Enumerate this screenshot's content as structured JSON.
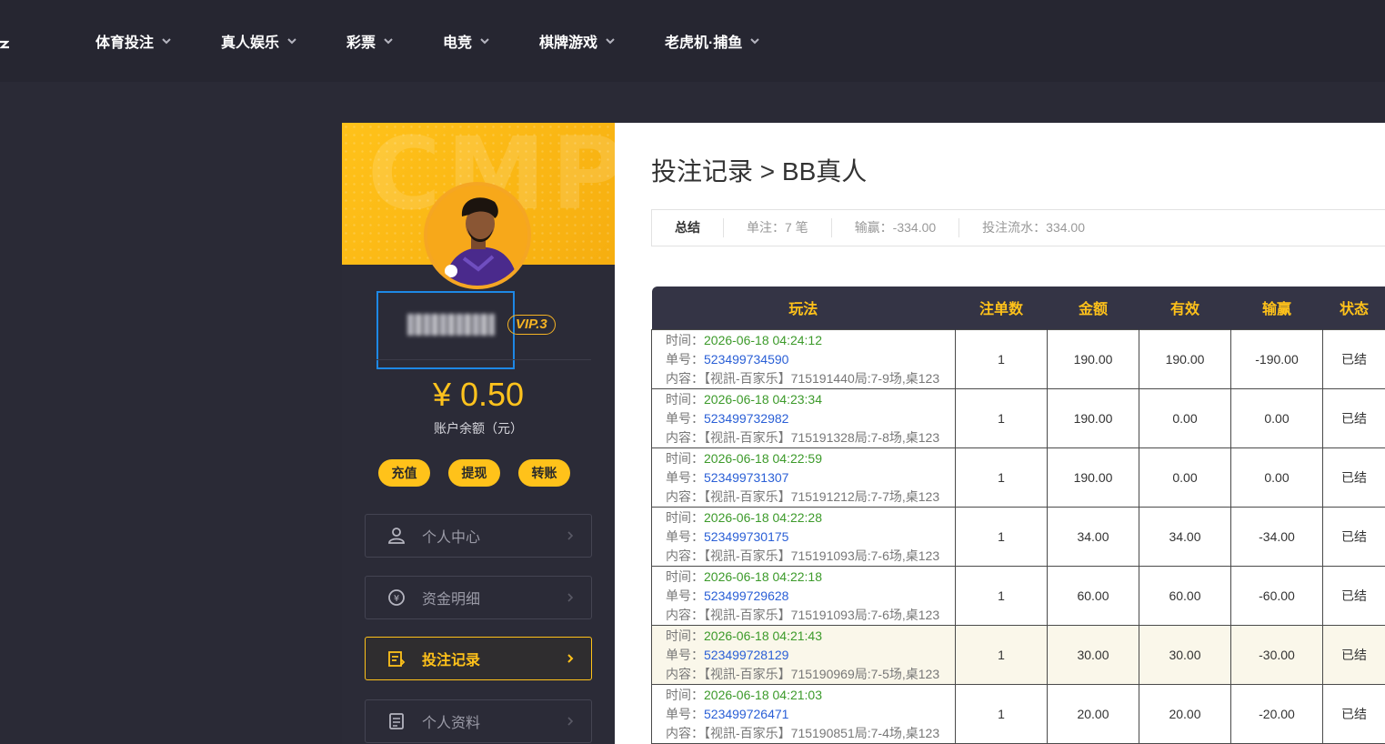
{
  "nav": {
    "items": [
      {
        "label": "体育投注"
      },
      {
        "label": "真人娱乐"
      },
      {
        "label": "彩票"
      },
      {
        "label": "电竞"
      },
      {
        "label": "棋牌游戏"
      },
      {
        "label": "老虎机·捕鱼"
      }
    ]
  },
  "sidebar": {
    "vip": "VIP.3",
    "balance": "¥ 0.50",
    "balance_label": "账户余额（元）",
    "actions": {
      "deposit": "充值",
      "withdraw": "提现",
      "transfer": "转账"
    },
    "menu": [
      {
        "label": "个人中心",
        "icon": "user-icon"
      },
      {
        "label": "资金明细",
        "icon": "yuan-cycle-icon"
      },
      {
        "label": "投注记录",
        "icon": "bet-record-icon",
        "active": true
      },
      {
        "label": "个人资料",
        "icon": "profile-doc-icon"
      }
    ],
    "accent_color": "#ffc21a"
  },
  "main": {
    "title": "投注记录 > BB真人",
    "summary": {
      "label": "总结",
      "bets": "单注：7 笔",
      "win_loss": "输赢：-334.00",
      "turnover": "投注流水：334.00"
    },
    "table": {
      "headers": [
        "玩法",
        "注单数",
        "金额",
        "有效",
        "输赢",
        "状态"
      ],
      "time_label": "时间：",
      "order_label": "单号：",
      "content_label": "内容：",
      "rows": [
        {
          "time": "2026-06-18 04:24:12",
          "order": "523499734590",
          "content": "【视訊-百家乐】715191440局:7-9场,桌123",
          "count": "1",
          "amount": "190.00",
          "valid": "190.00",
          "win": "-190.00",
          "status": "已结",
          "negative": true
        },
        {
          "time": "2026-06-18 04:23:34",
          "order": "523499732982",
          "content": "【视訊-百家乐】715191328局:7-8场,桌123",
          "count": "1",
          "amount": "190.00",
          "valid": "0.00",
          "win": "0.00",
          "status": "已结",
          "negative": false
        },
        {
          "time": "2026-06-18 04:22:59",
          "order": "523499731307",
          "content": "【视訊-百家乐】715191212局:7-7场,桌123",
          "count": "1",
          "amount": "190.00",
          "valid": "0.00",
          "win": "0.00",
          "status": "已结",
          "negative": false
        },
        {
          "time": "2026-06-18 04:22:28",
          "order": "523499730175",
          "content": "【视訊-百家乐】715191093局:7-6场,桌123",
          "count": "1",
          "amount": "34.00",
          "valid": "34.00",
          "win": "-34.00",
          "status": "已结",
          "negative": true
        },
        {
          "time": "2026-06-18 04:22:18",
          "order": "523499729628",
          "content": "【视訊-百家乐】715191093局:7-6场,桌123",
          "count": "1",
          "amount": "60.00",
          "valid": "60.00",
          "win": "-60.00",
          "status": "已结",
          "negative": true
        },
        {
          "time": "2026-06-18 04:21:43",
          "order": "523499728129",
          "content": "【视訊-百家乐】715190969局:7-5场,桌123",
          "count": "1",
          "amount": "30.00",
          "valid": "30.00",
          "win": "-30.00",
          "status": "已结",
          "negative": true,
          "highlight": true
        },
        {
          "time": "2026-06-18 04:21:03",
          "order": "523499726471",
          "content": "【视訊-百家乐】715190851局:7-4场,桌123",
          "count": "1",
          "amount": "20.00",
          "valid": "20.00",
          "win": "-20.00",
          "status": "已结",
          "negative": true
        }
      ]
    }
  }
}
